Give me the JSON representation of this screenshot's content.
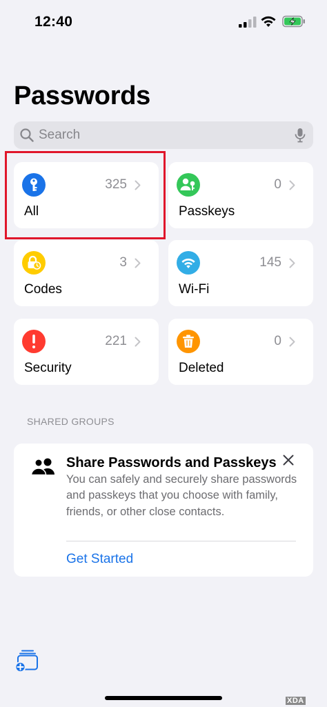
{
  "status_bar": {
    "time": "12:40"
  },
  "page": {
    "title": "Passwords"
  },
  "search": {
    "placeholder": "Search"
  },
  "tiles": [
    {
      "label": "All",
      "count": "325",
      "icon": "key-icon",
      "color": "#1a73e8"
    },
    {
      "label": "Passkeys",
      "count": "0",
      "icon": "person-key-icon",
      "color": "#34c759"
    },
    {
      "label": "Codes",
      "count": "3",
      "icon": "lock-clock-icon",
      "color": "#ffcc00"
    },
    {
      "label": "Wi-Fi",
      "count": "145",
      "icon": "wifi-icon",
      "color": "#32ade6"
    },
    {
      "label": "Security",
      "count": "221",
      "icon": "exclamation-icon",
      "color": "#ff3b30"
    },
    {
      "label": "Deleted",
      "count": "0",
      "icon": "trash-icon",
      "color": "#ff9500"
    }
  ],
  "shared_groups": {
    "header": "SHARED GROUPS",
    "card": {
      "title": "Share Passwords and Passkeys",
      "body": "You can safely and securely share passwords and passkeys that you choose with family, friends, or other close contacts.",
      "link": "Get Started"
    }
  },
  "watermark": "XDA",
  "colors": {
    "accent": "#1a73e8",
    "highlight": "#e0162b",
    "background": "#f2f2f7"
  }
}
